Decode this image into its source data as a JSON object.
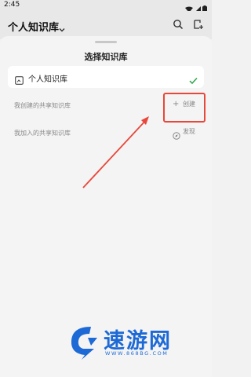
{
  "status_bar": {
    "time": "2:45"
  },
  "header": {
    "title": "个人知识库"
  },
  "sheet": {
    "title": "选择知识库",
    "selected_kb": {
      "label": "个人知识库"
    },
    "created_section": {
      "label": "我创建的共享知识库",
      "action_label": "创建"
    },
    "joined_section": {
      "label": "我加入的共享知识库",
      "action_label": "发现"
    }
  },
  "watermark": {
    "name": "速游网",
    "url": "WWW.868BG.COM"
  },
  "colors": {
    "accent_check": "#2ba84a",
    "annotation": "#e8473a",
    "watermark": "#1d6ad6"
  }
}
